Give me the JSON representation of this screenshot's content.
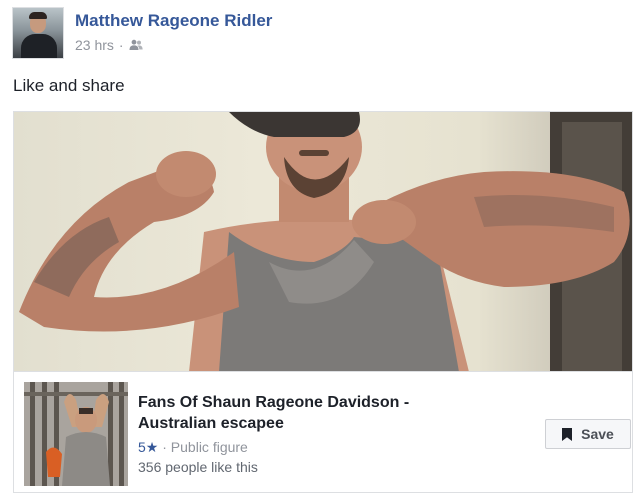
{
  "post": {
    "author": "Matthew Rageone Ridler",
    "timestamp": "23 hrs",
    "separator": "·",
    "audience_icon": "friends-icon",
    "text": "Like and share"
  },
  "shared_page": {
    "title": "Fans Of Shaun Rageone Davidson - Australian escapee",
    "rating": "5★",
    "separator": "·",
    "category": "Public figure",
    "likes": "356 people like this",
    "save_label": "Save",
    "save_icon": "bookmark-icon"
  }
}
